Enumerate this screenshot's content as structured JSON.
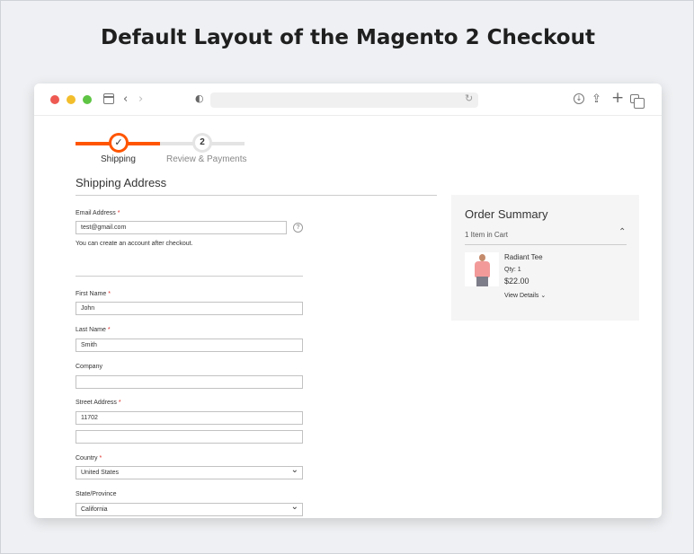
{
  "page": {
    "heading": "Default Layout of the Magento 2 Checkout"
  },
  "browser": {
    "icons": [
      "sidebar-icon",
      "back-icon",
      "forward-icon",
      "shield-icon",
      "reload-icon",
      "download-icon",
      "share-icon",
      "plus-icon",
      "tabs-icon"
    ]
  },
  "progress": {
    "steps": [
      {
        "number": "✓",
        "label": "Shipping",
        "active": true
      },
      {
        "number": "2",
        "label": "Review & Payments",
        "active": false
      }
    ],
    "fill_fraction": 0.5,
    "accent_color": "#ff5501"
  },
  "shipping": {
    "title": "Shipping Address",
    "email": {
      "label": "Email Address",
      "required": "*",
      "value": "test@gmail.com",
      "help": "?",
      "note": "You can create an account after checkout."
    },
    "first_name": {
      "label": "First Name",
      "required": "*",
      "value": "John"
    },
    "last_name": {
      "label": "Last Name",
      "required": "*",
      "value": "Smith"
    },
    "company": {
      "label": "Company",
      "value": ""
    },
    "street": {
      "label": "Street Address",
      "required": "*",
      "line1": "11702",
      "line2": ""
    },
    "country": {
      "label": "Country",
      "required": "*",
      "value": "United States"
    },
    "state": {
      "label": "State/Province",
      "value": "California"
    }
  },
  "summary": {
    "title": "Order Summary",
    "count": "1 Item in Cart",
    "toggle": "⌃",
    "item": {
      "name": "Radiant Tee",
      "qty": "Qty: 1",
      "price": "$22.00",
      "details": "View Details ⌄"
    }
  }
}
